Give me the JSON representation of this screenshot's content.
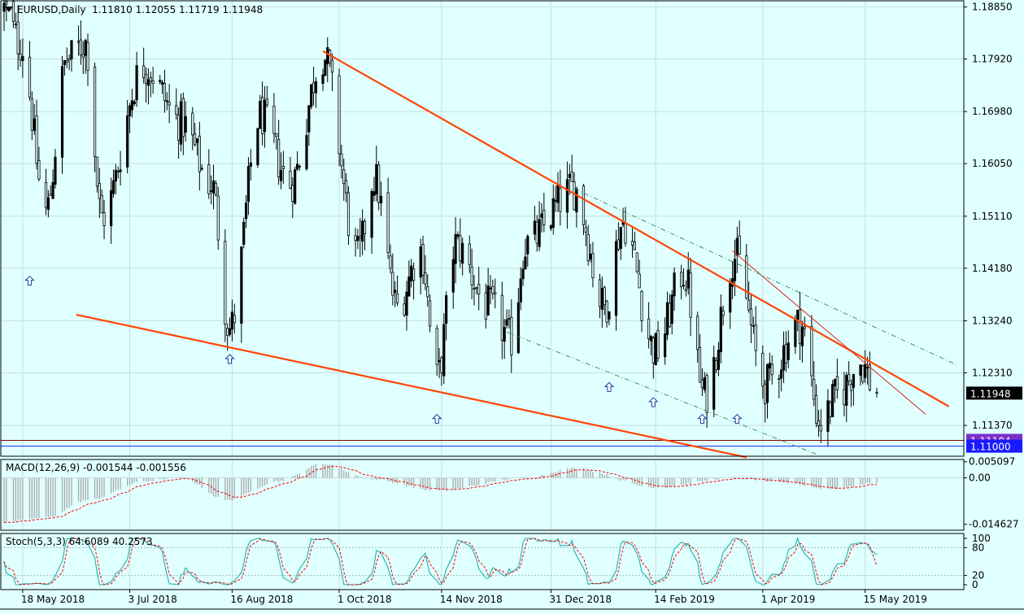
{
  "header": {
    "symbol_timeframe": "EURUSD,Daily",
    "ohlc": "1.11810 1.12055 1.11719 1.11948"
  },
  "colors": {
    "background": "#e0ffff",
    "grid": "#c8dede",
    "frame": "#000000",
    "bull_candle": "#000000",
    "trendline": "#ff4500",
    "thin_trendline": "#e0201a",
    "channel_dash": "#2e8b57",
    "signal_arrow": "#1a3ea8",
    "support_line_1": "#8b0000",
    "support_line_2": "#2020ff",
    "macd_hist": "#a9a9a9",
    "macd_signal": "#ff0000",
    "stoch_main": "#20b2aa",
    "stoch_signal": "#ff0000",
    "label_current": "#000000",
    "label_support": "#1a1aff"
  },
  "chart_data": [
    {
      "type": "candlestick",
      "name": "EURUSD Daily",
      "x_range": [
        "2018-05-10",
        "2019-05-20"
      ],
      "ylim": [
        1.1082,
        1.1896
      ],
      "y_ticks": [
        "1.18850",
        "1.17920",
        "1.16980",
        "1.16050",
        "1.15110",
        "1.14180",
        "1.13240",
        "1.12310",
        "1.11370"
      ],
      "x_ticks": [
        "18 May 2018",
        "3 Jul 2018",
        "16 Aug 2018",
        "1 Oct 2018",
        "14 Nov 2018",
        "31 Dec 2018",
        "14 Feb 2019",
        "1 Apr 2019",
        "15 May 2019"
      ],
      "x_tick_dates": [
        "2018-05-18",
        "2018-07-03",
        "2018-08-16",
        "2018-10-01",
        "2018-11-14",
        "2018-12-31",
        "2019-02-14",
        "2019-04-01",
        "2019-05-15"
      ],
      "price_anchors": [
        {
          "date": "2018-05-10",
          "price": 1.188
        },
        {
          "date": "2018-05-17",
          "price": 1.182
        },
        {
          "date": "2018-05-28",
          "price": 1.152
        },
        {
          "date": "2018-06-06",
          "price": 1.179
        },
        {
          "date": "2018-06-14",
          "price": 1.182
        },
        {
          "date": "2018-06-21",
          "price": 1.151
        },
        {
          "date": "2018-07-09",
          "price": 1.178
        },
        {
          "date": "2018-07-25",
          "price": 1.168
        },
        {
          "date": "2018-08-07",
          "price": 1.157
        },
        {
          "date": "2018-08-15",
          "price": 1.131
        },
        {
          "date": "2018-08-28",
          "price": 1.169
        },
        {
          "date": "2018-09-10",
          "price": 1.157
        },
        {
          "date": "2018-09-24",
          "price": 1.18
        },
        {
          "date": "2018-10-09",
          "price": 1.144
        },
        {
          "date": "2018-10-16",
          "price": 1.158
        },
        {
          "date": "2018-10-26",
          "price": 1.135
        },
        {
          "date": "2018-11-05",
          "price": 1.145
        },
        {
          "date": "2018-11-12",
          "price": 1.122
        },
        {
          "date": "2018-11-20",
          "price": 1.146
        },
        {
          "date": "2018-12-04",
          "price": 1.135
        },
        {
          "date": "2018-12-14",
          "price": 1.129
        },
        {
          "date": "2018-12-20",
          "price": 1.146
        },
        {
          "date": "2019-01-10",
          "price": 1.156
        },
        {
          "date": "2019-01-23",
          "price": 1.135
        },
        {
          "date": "2019-01-31",
          "price": 1.15
        },
        {
          "date": "2019-02-14",
          "price": 1.127
        },
        {
          "date": "2019-02-26",
          "price": 1.141
        },
        {
          "date": "2019-03-07",
          "price": 1.119
        },
        {
          "date": "2019-03-20",
          "price": 1.144
        },
        {
          "date": "2019-04-02",
          "price": 1.121
        },
        {
          "date": "2019-04-17",
          "price": 1.132
        },
        {
          "date": "2019-04-26",
          "price": 1.114
        },
        {
          "date": "2019-05-03",
          "price": 1.119
        },
        {
          "date": "2019-05-13",
          "price": 1.125
        },
        {
          "date": "2019-05-20",
          "price": 1.1195
        }
      ],
      "current_price_label": "1.11948",
      "current_price": 1.11948,
      "horizontal_lines": [
        {
          "label": "1.11104",
          "price": 1.11104
        },
        {
          "label": "1.11000",
          "price": 1.11
        }
      ],
      "trendlines": [
        {
          "kind": "thick",
          "from": {
            "date": "2018-09-24",
            "price": 1.1806
          },
          "to": {
            "date": "2019-06-20",
            "price": 1.1171
          }
        },
        {
          "kind": "thick",
          "from": {
            "date": "2018-06-10",
            "price": 1.1335
          },
          "to": {
            "date": "2019-03-25",
            "price": 1.108
          }
        },
        {
          "kind": "thin",
          "from": {
            "date": "2019-03-19",
            "price": 1.1449
          },
          "to": {
            "date": "2019-06-10",
            "price": 1.1157
          }
        },
        {
          "kind": "dash",
          "from": {
            "date": "2019-01-10",
            "price": 1.156
          },
          "to": {
            "date": "2019-06-23",
            "price": 1.1246
          }
        },
        {
          "kind": "dash",
          "from": {
            "date": "2018-12-12",
            "price": 1.1304
          },
          "to": {
            "date": "2019-04-25",
            "price": 1.1084
          }
        }
      ],
      "signal_arrows": [
        {
          "date": "2018-05-21",
          "price": 1.1395
        },
        {
          "date": "2018-08-15",
          "price": 1.1255
        },
        {
          "date": "2018-11-12",
          "price": 1.1148
        },
        {
          "date": "2019-01-25",
          "price": 1.1205
        },
        {
          "date": "2019-02-13",
          "price": 1.1178
        },
        {
          "date": "2019-03-06",
          "price": 1.1148
        },
        {
          "date": "2019-03-21",
          "price": 1.1148
        }
      ]
    },
    {
      "type": "bar",
      "name": "MACD",
      "label": "MACD(12,26,9) -0.001544 -0.001556",
      "ylim": [
        -0.0165,
        0.0058
      ],
      "y_ticks": [
        "0.005097",
        "0.00",
        "-0.014627"
      ],
      "anchors": [
        {
          "date": "2018-05-10",
          "value": -0.014
        },
        {
          "date": "2018-05-28",
          "value": -0.0125
        },
        {
          "date": "2018-06-15",
          "value": -0.007
        },
        {
          "date": "2018-07-10",
          "value": -0.001
        },
        {
          "date": "2018-07-25",
          "value": 0.0
        },
        {
          "date": "2018-08-14",
          "value": -0.007
        },
        {
          "date": "2018-09-05",
          "value": -0.001
        },
        {
          "date": "2018-09-24",
          "value": 0.0045
        },
        {
          "date": "2018-10-15",
          "value": -0.0005
        },
        {
          "date": "2018-11-12",
          "value": -0.004
        },
        {
          "date": "2018-12-20",
          "value": 0.0
        },
        {
          "date": "2019-01-10",
          "value": 0.003
        },
        {
          "date": "2019-02-14",
          "value": -0.003
        },
        {
          "date": "2019-03-20",
          "value": 0.0
        },
        {
          "date": "2019-04-10",
          "value": -0.0015
        },
        {
          "date": "2019-04-30",
          "value": -0.0035
        },
        {
          "date": "2019-05-20",
          "value": -0.0015
        }
      ]
    },
    {
      "type": "line",
      "name": "Stochastic",
      "label": "Stoch(5,3,3) 64.6089 40.2573",
      "ylim": [
        0,
        100
      ],
      "y_ticks": [
        "100",
        "80",
        "20",
        "0"
      ],
      "k_value": 64.6089,
      "d_value": 40.2573
    }
  ]
}
